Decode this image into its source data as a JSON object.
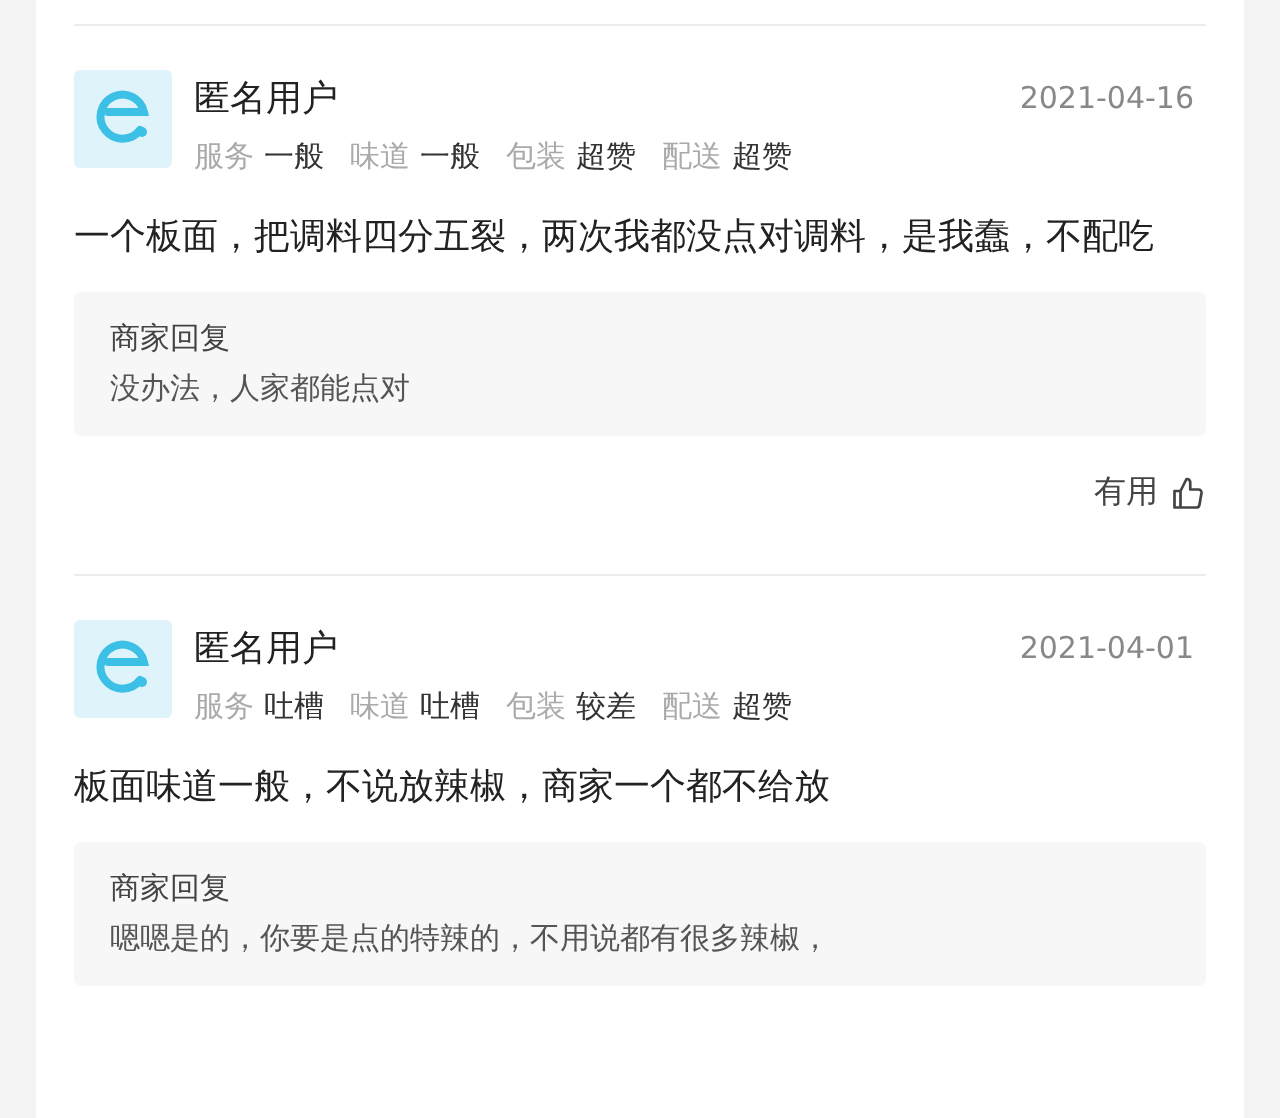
{
  "reviews": [
    {
      "user": "匿名用户",
      "date": "2021-04-16",
      "ratings": [
        {
          "label": "服务",
          "value": "一般"
        },
        {
          "label": "味道",
          "value": "一般"
        },
        {
          "label": "包装",
          "value": "超赞"
        },
        {
          "label": "配送",
          "value": "超赞"
        }
      ],
      "text": "一个板面，把调料四分五裂，两次我都没点对调料，是我蠢，不配吃",
      "reply": {
        "title": "商家回复",
        "text": "没办法，人家都能点对"
      },
      "useful": "有用"
    },
    {
      "user": "匿名用户",
      "date": "2021-04-01",
      "ratings": [
        {
          "label": "服务",
          "value": "吐槽"
        },
        {
          "label": "味道",
          "value": "吐槽"
        },
        {
          "label": "包装",
          "value": "较差"
        },
        {
          "label": "配送",
          "value": "超赞"
        }
      ],
      "text": "板面味道一般，不说放辣椒，商家一个都不给放",
      "reply": {
        "title": "商家回复",
        "text": "嗯嗯是的，你要是点的特辣的，不用说都有很多辣椒，"
      }
    }
  ]
}
